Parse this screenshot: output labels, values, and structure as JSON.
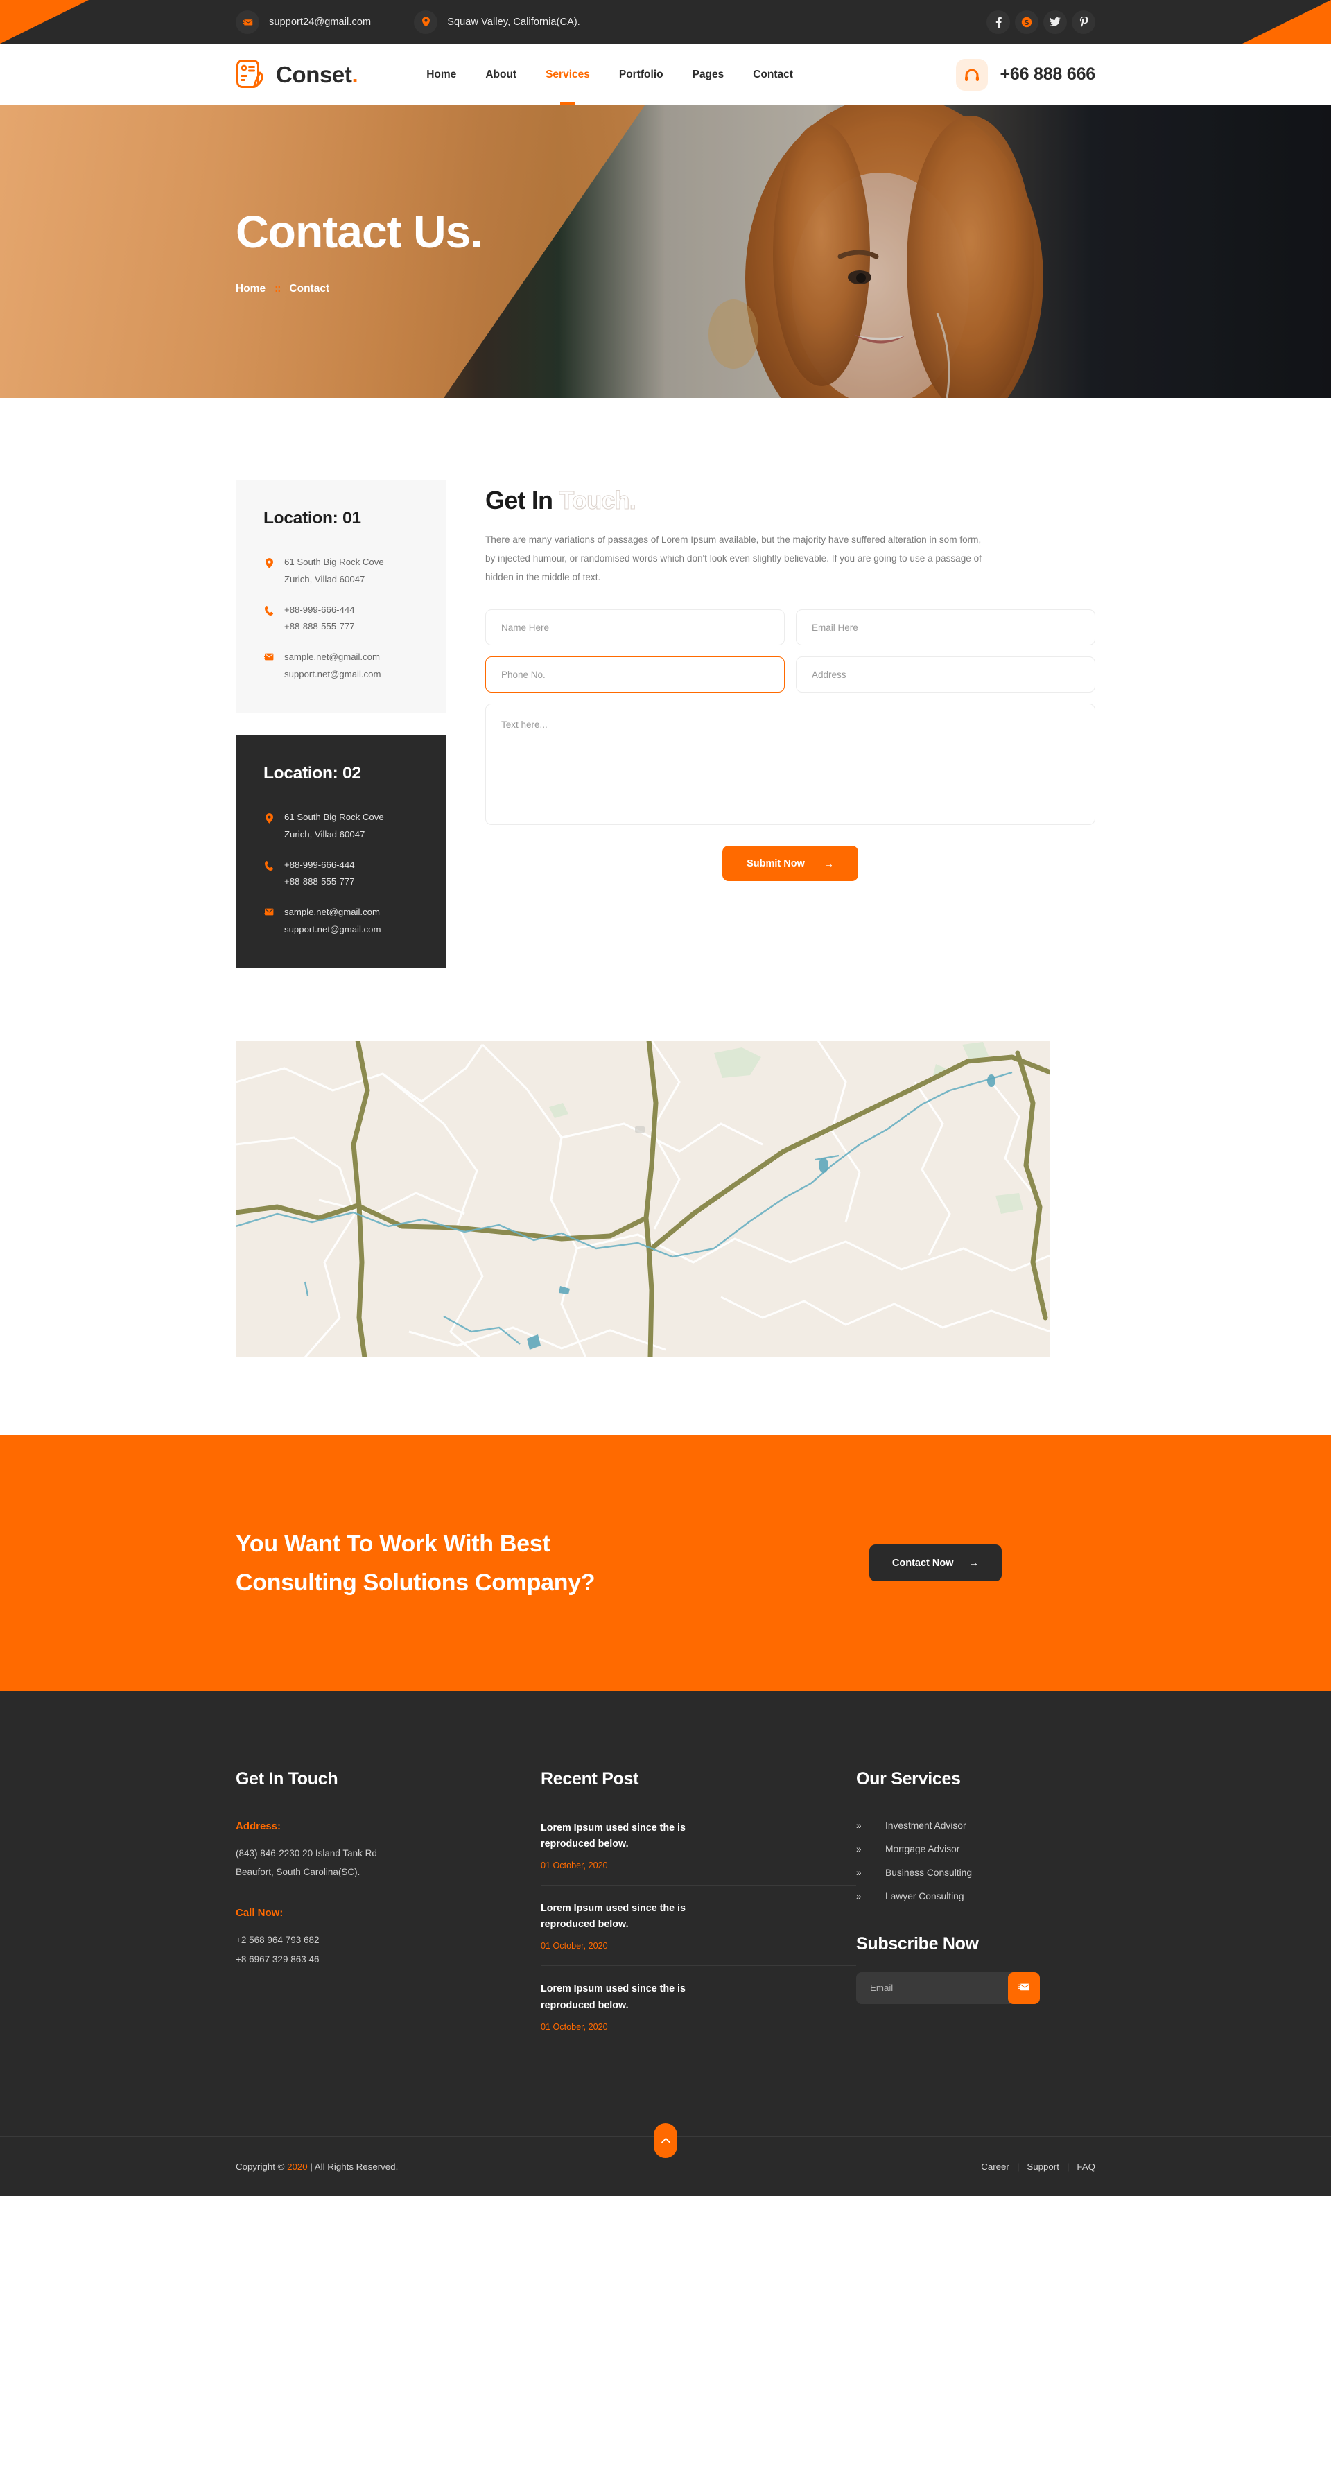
{
  "topbar": {
    "email": "support24@gmail.com",
    "location": "Squaw Valley, California(CA).",
    "social": [
      {
        "name": "facebook",
        "glyph": "f"
      },
      {
        "name": "skype",
        "glyph": "S"
      },
      {
        "name": "twitter",
        "glyph": "t"
      },
      {
        "name": "pinterest",
        "glyph": "P"
      }
    ]
  },
  "header": {
    "brand": "Conset",
    "brand_dot": ".",
    "nav": [
      {
        "label": "Home",
        "active": false
      },
      {
        "label": "About",
        "active": false
      },
      {
        "label": "Services",
        "active": true
      },
      {
        "label": "Portfolio",
        "active": false
      },
      {
        "label": "Pages",
        "active": false
      },
      {
        "label": "Contact",
        "active": false
      }
    ],
    "phone": "+66 888 666"
  },
  "hero": {
    "title": "Contact Us.",
    "breadcrumb_home": "Home",
    "breadcrumb_sep": "::",
    "breadcrumb_current": "Contact"
  },
  "locations": [
    {
      "title": "Location: 01",
      "address": [
        "61 South Big Rock Cove",
        "Zurich, Villad 60047"
      ],
      "phones": [
        "+88-999-666-444",
        "+88-888-555-777"
      ],
      "emails": [
        "sample.net@gmail.com",
        "support.net@gmail.com"
      ]
    },
    {
      "title": "Location: 02",
      "address": [
        "61 South Big Rock Cove",
        "Zurich, Villad 60047"
      ],
      "phones": [
        "+88-999-666-444",
        "+88-888-555-777"
      ],
      "emails": [
        "sample.net@gmail.com",
        "support.net@gmail.com"
      ]
    }
  ],
  "form": {
    "heading_solid": "Get In ",
    "heading_outline": "Touch.",
    "description": "There are many variations of passages of Lorem Ipsum available, but the majority have suffered alteration in som form, by injected humour, or randomised words which don't look even slightly believable. If you are going to use a passage of hidden in the middle of text.",
    "name_placeholder": "Name Here",
    "email_placeholder": "Email Here",
    "phone_placeholder": "Phone No.",
    "address_placeholder": "Address",
    "message_placeholder": "Text here...",
    "submit_label": "Submit Now",
    "submit_arrow": "→"
  },
  "cta": {
    "line1": "You Want To Work With Best",
    "line2": "Consulting Solutions Company?",
    "button_label": "Contact Now",
    "button_arrow": "→"
  },
  "footer": {
    "get_in_touch_title": "Get In Touch",
    "address_label": "Address:",
    "address_lines": [
      "(843) 846-2230 20 Island Tank Rd",
      "Beaufort, South Carolina(SC)."
    ],
    "call_label": "Call Now:",
    "call_lines": [
      "+2 568 964 793 682",
      "+8 6967 329 863 46"
    ],
    "recent_post_title": "Recent Post",
    "posts": [
      {
        "title": "Lorem Ipsum used since the is reproduced below.",
        "date": "01 October, 2020"
      },
      {
        "title": "Lorem Ipsum used since the is reproduced below.",
        "date": "01 October, 2020"
      },
      {
        "title": "Lorem Ipsum used since the is reproduced below.",
        "date": "01 October, 2020"
      }
    ],
    "services_title": "Our Services",
    "services": [
      "Investment Advisor",
      "Mortgage Advisor",
      "Business Consulting",
      "Lawyer Consulting"
    ],
    "service_arrow": "»",
    "subscribe_title": "Subscribe Now",
    "subscribe_placeholder": "Email"
  },
  "copyright": {
    "prefix": "Copyright © ",
    "year": "2020",
    "suffix": "  |  All Rights Reserved.",
    "links": [
      "Career",
      "Support",
      "FAQ"
    ],
    "divider": "|"
  },
  "colors": {
    "accent": "#ff6a00",
    "dark": "#2a2a2a",
    "light_panel": "#f7f7f7"
  }
}
